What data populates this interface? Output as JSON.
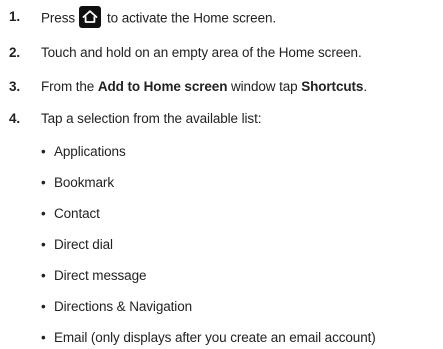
{
  "steps": [
    {
      "number": "1.",
      "before": "Press",
      "icon": "home-key-icon",
      "after": "to activate the Home screen."
    },
    {
      "number": "2.",
      "text": "Touch and hold on an empty area of the Home screen."
    },
    {
      "number": "3.",
      "prefix": "From the ",
      "bold1": "Add to Home screen",
      "middle": " window tap ",
      "bold2": "Shortcuts",
      "suffix": "."
    },
    {
      "number": "4.",
      "text": "Tap a selection from the available list:"
    }
  ],
  "bullet_char": "•",
  "options": [
    "Applications",
    "Bookmark",
    "Contact",
    "Direct dial",
    "Direct message",
    "Directions & Navigation",
    "Email (only displays after you create an email account)"
  ],
  "colors": {
    "text": "#222222",
    "home_key_bg": "#0f0f0f",
    "home_key_glyph": "#ffffff"
  }
}
